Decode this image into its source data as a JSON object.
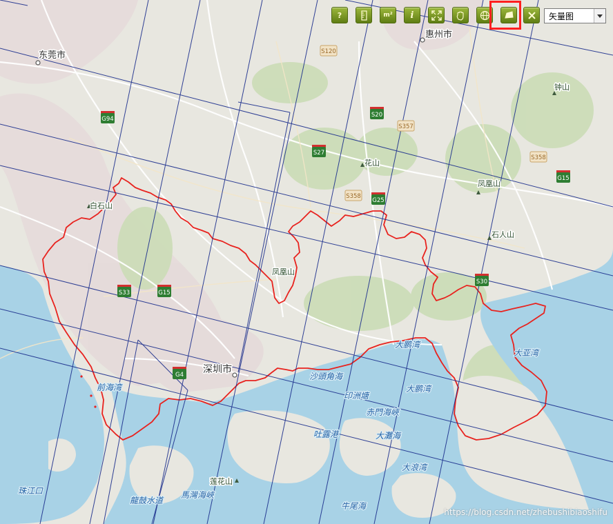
{
  "map": {
    "cities": [
      {
        "name": "东莞市"
      },
      {
        "name": "惠州市"
      },
      {
        "name": "深圳市"
      }
    ],
    "mountains": [
      {
        "name": "白石山"
      },
      {
        "name": "花山"
      },
      {
        "name": "凤凰山"
      },
      {
        "name": "石人山"
      },
      {
        "name": "钟山"
      },
      {
        "name": "凤凰山"
      },
      {
        "name": "莲花山"
      }
    ],
    "water_labels": [
      {
        "name": "前海湾"
      },
      {
        "name": "大鹏湾"
      },
      {
        "name": "大鹏湾"
      },
      {
        "name": "大亚湾"
      },
      {
        "name": "沙頭角海"
      },
      {
        "name": "印洲塘"
      },
      {
        "name": "赤門海峽"
      },
      {
        "name": "吐露港"
      },
      {
        "name": "大灘海"
      },
      {
        "name": "大浪湾"
      },
      {
        "name": "珠江口"
      },
      {
        "name": "龍鼓水道"
      },
      {
        "name": "馬灣海峽"
      },
      {
        "name": "牛尾海"
      }
    ],
    "highway_shields": [
      {
        "code": "G94",
        "type": "national"
      },
      {
        "code": "S20",
        "type": "national"
      },
      {
        "code": "S27",
        "type": "national"
      },
      {
        "code": "G25",
        "type": "national"
      },
      {
        "code": "G15",
        "type": "national"
      },
      {
        "code": "S30",
        "type": "national"
      },
      {
        "code": "S33",
        "type": "national"
      },
      {
        "code": "G15",
        "type": "national"
      },
      {
        "code": "G4",
        "type": "national"
      },
      {
        "code": "S120",
        "type": "provincial"
      },
      {
        "code": "S357",
        "type": "provincial"
      },
      {
        "code": "S358",
        "type": "provincial"
      },
      {
        "code": "S358",
        "type": "provincial"
      }
    ]
  },
  "toolbar": {
    "buttons": [
      {
        "name": "help-button",
        "icon": "question-icon",
        "label": "?"
      },
      {
        "name": "measure-distance-button",
        "icon": "ruler-icon",
        "label": ""
      },
      {
        "name": "measure-area-button",
        "icon": "area-icon",
        "label": "m²"
      },
      {
        "name": "info-button",
        "icon": "info-icon",
        "label": "i"
      },
      {
        "name": "full-extent-button",
        "icon": "expand-icon",
        "label": ""
      },
      {
        "name": "pan-button",
        "icon": "hand-icon",
        "label": ""
      },
      {
        "name": "globe-button",
        "icon": "globe-icon",
        "label": ""
      },
      {
        "name": "polygon-button",
        "icon": "polygon-icon",
        "label": ""
      },
      {
        "name": "clear-button",
        "icon": "close-icon",
        "label": ""
      }
    ],
    "map_type_select": "矢量图"
  },
  "watermark": "https://blog.csdn.net/zhebushibiaoshifu",
  "colors": {
    "land": "#e9e8e2",
    "sea": "#a9d3e7",
    "green": "#c9dcb6",
    "urban": "#e3d8d8",
    "boundary": "#e8221e",
    "grid": "#1a2d8c",
    "toolbar": "#6d8a1c",
    "highlight": "#ff1f1f"
  }
}
